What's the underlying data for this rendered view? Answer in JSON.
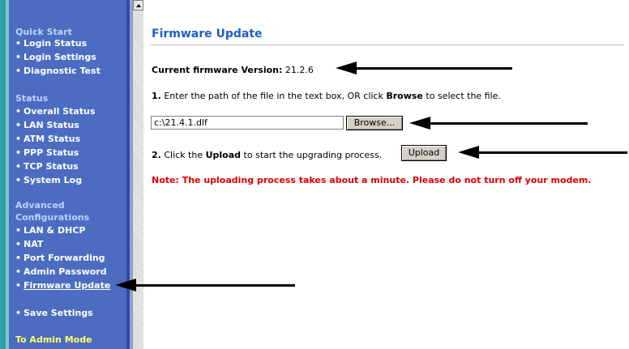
{
  "sidebar": {
    "sections": [
      {
        "title": "Quick Start",
        "items": [
          "Login Status",
          "Login Settings",
          "Diagnostic Test"
        ]
      },
      {
        "title": "Status",
        "items": [
          "Overall Status",
          "LAN Status",
          "ATM Status",
          "PPP Status",
          "TCP Status",
          "System Log"
        ]
      },
      {
        "title_line1": "Advanced",
        "title_line2": "Configurations",
        "items": [
          "LAN & DHCP",
          "NAT",
          "Port Forwarding",
          "Admin Password",
          "Firmware Update"
        ]
      }
    ],
    "save_settings": "Save Settings",
    "admin_mode": "To Admin Mode",
    "bullet": "•"
  },
  "main": {
    "title": "Firmware Update",
    "firmware_label": "Current firmware Version:",
    "firmware_value": "21.2.6",
    "step1_num": "1.",
    "step1_text_a": "Enter the path of the file in the text box, OR click",
    "step1_bold": "Browse",
    "step1_text_b": "to select the file.",
    "path_value": "c:\\21.4.1.dlf",
    "browse_label": "Browse...",
    "step2_num": "2.",
    "step2_text_a": "Click the",
    "step2_bold": "Upload",
    "step2_text_b": "to start the upgrading process.",
    "upload_label": "Upload",
    "note": "Note: The uploading process takes about a minute. Please do not turn off your modem."
  },
  "colors": {
    "sidebar_bg": "#4b6cc0",
    "title_blue": "#1f5ec8",
    "note_red": "#e00000",
    "admin_yellow": "#ffff66"
  }
}
